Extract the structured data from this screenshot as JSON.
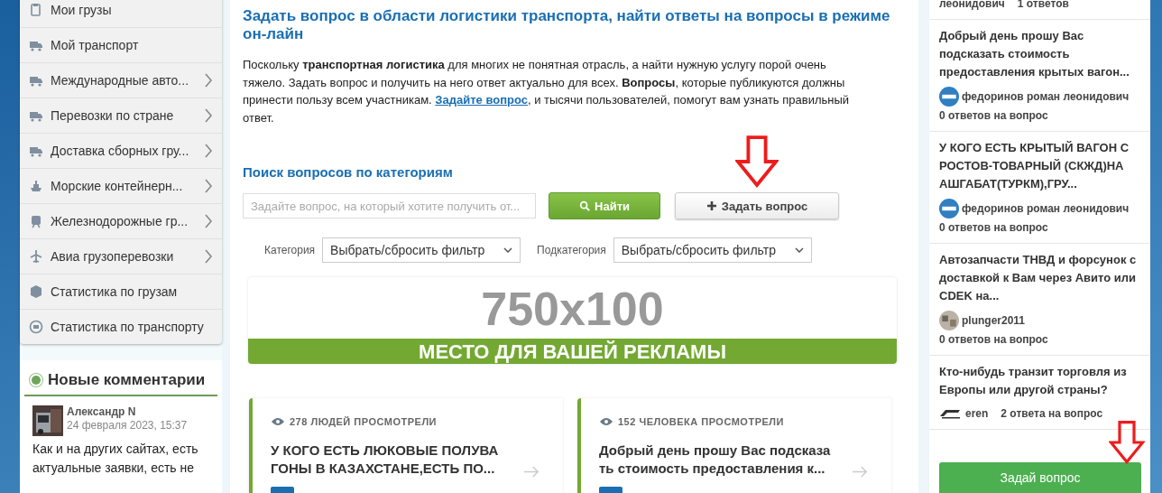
{
  "sidebar": {
    "menu": [
      {
        "label": "Мои грузы",
        "has_submenu": false
      },
      {
        "label": "Мой транспорт",
        "has_submenu": false
      },
      {
        "label": "Международные авто...",
        "has_submenu": true
      },
      {
        "label": "Перевозки по стране",
        "has_submenu": true
      },
      {
        "label": "Доставка сборных гру...",
        "has_submenu": true
      },
      {
        "label": "Морские контейнерн...",
        "has_submenu": true
      },
      {
        "label": "Железнодорожные гр...",
        "has_submenu": true
      },
      {
        "label": "Авиа грузоперевозки",
        "has_submenu": true
      },
      {
        "label": "Статистика по грузам",
        "has_submenu": false
      },
      {
        "label": "Статистика по транспорту",
        "has_submenu": false
      }
    ],
    "comments": {
      "title": "Новые комментарии",
      "items": [
        {
          "author": "Александр N",
          "date": "24 февраля 2023, 15:37",
          "text": "Как и на других сайтах, есть актуальные заявки, есть не"
        }
      ]
    }
  },
  "main": {
    "title": "Задать вопрос в области логистики транспорта, найти ответы на вопросы в режиме он-лайн",
    "intro": [
      {
        "text": "Поскольку **транспортная логистика** для многих не понятная отрасль, а найти нужную услугу порой очень тяжело. Задать вопрос и получить на него ответ актуально для всех. **Вопросы**, которые публикуются должны принести пользу всем участникам. "
      },
      {
        "link": "Задайте вопрос"
      },
      {
        "text": ", и тысячи пользователей, помогут вам узнать правильный ответ."
      }
    ],
    "search": {
      "heading": "Поиск вопросов по категориям",
      "placeholder": "Задайте вопрос, на который хотите получить от...",
      "find_button": "Найти",
      "ask_button": "Задать вопрос"
    },
    "filters": [
      {
        "label": "Категория",
        "value": "Выбрать/сбросить фильтр"
      },
      {
        "label": "Подкатегория",
        "value": "Выбрать/сбросить фильтр"
      }
    ],
    "banner": {
      "size": "750x100",
      "caption": "МЕСТО ДЛЯ ВАШЕЙ РЕКЛАМЫ"
    },
    "cards": [
      {
        "views": "278 ЛЮДЕЙ ПРОСМОТРЕЛИ",
        "title": "У КОГО ЕСТЬ ЛЮКОВЫЕ ПОЛУВА ГОНЫ В КАЗАХСТАНЕ,ЕСТЬ ПО..."
      },
      {
        "views": "152 ЧЕЛОВЕКА ПРОСМОТРЕЛИ",
        "title": "Добрый день прошу Вас подсказа ть стоимость предоставления к..."
      }
    ]
  },
  "questions": [
    {
      "kind": "partial",
      "author": "леонидович",
      "answers": "1 ответов"
    },
    {
      "kind": "badge",
      "title": "Добрый день прошу Вас подсказать стоимость предоставления крытых вагон...",
      "author": "федоринов роман леонидович",
      "answers": "0 ответов на вопрос"
    },
    {
      "kind": "badge",
      "title": "У КОГО ЕСТЬ КРЫТЫЙ ВАГОН С РОСТОВ-ТОВАРНЫЙ (СКЖД)НА АШГАБАТ(ТУРКМ),ГРУ...",
      "author": "федоринов роман леонидович",
      "answers": "0 ответов на вопрос"
    },
    {
      "title": "Автозапчасти ТНВД и форсунок с доставкой к Вам через Авито или CDEK на...",
      "author": "plunger2011",
      "answers": "0 ответов на вопрос"
    },
    {
      "kind": "logo",
      "title": "Кто-нибудь транзит торговля из Европы или другой страны?",
      "author": "eren",
      "answers": "2 ответа на вопрос"
    }
  ],
  "ask_button": "Задай вопрос"
}
